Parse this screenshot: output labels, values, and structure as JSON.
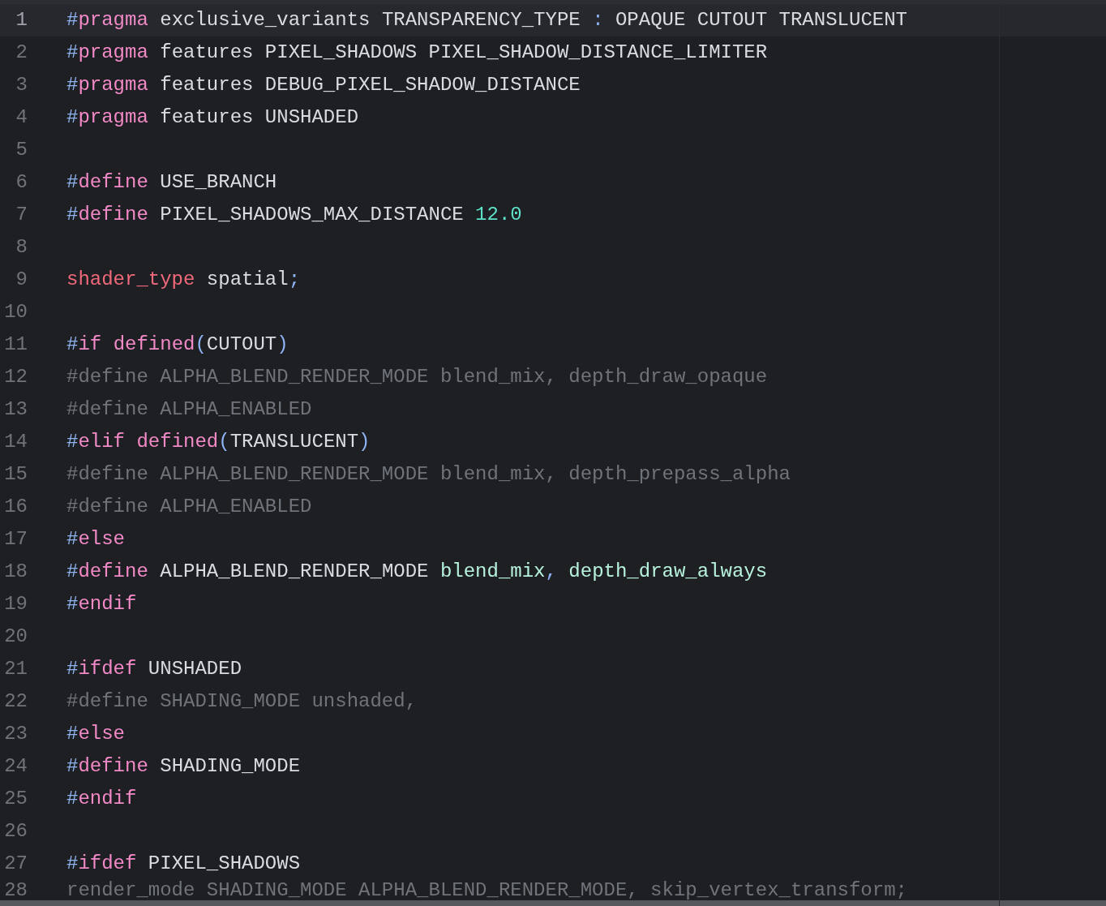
{
  "editor": {
    "lines": [
      {
        "number": "1",
        "current": true,
        "tokens": [
          {
            "kind": "hash",
            "text": "#"
          },
          {
            "kind": "directive",
            "text": "pragma"
          },
          {
            "kind": "plain",
            "text": " exclusive_variants TRANSPARENCY_TYPE "
          },
          {
            "kind": "punct",
            "text": ":"
          },
          {
            "kind": "plain",
            "text": " OPAQUE CUTOUT TRANSLUCENT"
          }
        ]
      },
      {
        "number": "2",
        "current": false,
        "tokens": [
          {
            "kind": "hash",
            "text": "#"
          },
          {
            "kind": "directive",
            "text": "pragma"
          },
          {
            "kind": "plain",
            "text": " features PIXEL_SHADOWS PIXEL_SHADOW_DISTANCE_LIMITER"
          }
        ]
      },
      {
        "number": "3",
        "current": false,
        "tokens": [
          {
            "kind": "hash",
            "text": "#"
          },
          {
            "kind": "directive",
            "text": "pragma"
          },
          {
            "kind": "plain",
            "text": " features DEBUG_PIXEL_SHADOW_DISTANCE"
          }
        ]
      },
      {
        "number": "4",
        "current": false,
        "tokens": [
          {
            "kind": "hash",
            "text": "#"
          },
          {
            "kind": "directive",
            "text": "pragma"
          },
          {
            "kind": "plain",
            "text": " features UNSHADED"
          }
        ]
      },
      {
        "number": "5",
        "current": false
      },
      {
        "number": "6",
        "current": false,
        "tokens": [
          {
            "kind": "hash",
            "text": "#"
          },
          {
            "kind": "directive",
            "text": "define"
          },
          {
            "kind": "plain",
            "text": " USE_BRANCH"
          }
        ]
      },
      {
        "number": "7",
        "current": false,
        "tokens": [
          {
            "kind": "hash",
            "text": "#"
          },
          {
            "kind": "directive",
            "text": "define"
          },
          {
            "kind": "plain",
            "text": " PIXEL_SHADOWS_MAX_DISTANCE "
          },
          {
            "kind": "number",
            "text": "12.0"
          }
        ]
      },
      {
        "number": "8",
        "current": false
      },
      {
        "number": "9",
        "current": false,
        "tokens": [
          {
            "kind": "keyword",
            "text": "shader_type"
          },
          {
            "kind": "plain",
            "text": " spatial"
          },
          {
            "kind": "punct",
            "text": ";"
          }
        ]
      },
      {
        "number": "10",
        "current": false
      },
      {
        "number": "11",
        "current": false,
        "tokens": [
          {
            "kind": "hash",
            "text": "#"
          },
          {
            "kind": "directive",
            "text": "if "
          },
          {
            "kind": "directive",
            "text": "defined"
          },
          {
            "kind": "punct",
            "text": "("
          },
          {
            "kind": "plain",
            "text": "CUTOUT"
          },
          {
            "kind": "punct",
            "text": ")"
          }
        ]
      },
      {
        "number": "12",
        "current": false,
        "tokens": [
          {
            "kind": "inactive",
            "text": "#define ALPHA_BLEND_RENDER_MODE blend_mix, depth_draw_opaque"
          }
        ]
      },
      {
        "number": "13",
        "current": false,
        "tokens": [
          {
            "kind": "inactive",
            "text": "#define ALPHA_ENABLED"
          }
        ]
      },
      {
        "number": "14",
        "current": false,
        "tokens": [
          {
            "kind": "hash",
            "text": "#"
          },
          {
            "kind": "directive",
            "text": "elif "
          },
          {
            "kind": "directive",
            "text": "defined"
          },
          {
            "kind": "punct",
            "text": "("
          },
          {
            "kind": "plain",
            "text": "TRANSLUCENT"
          },
          {
            "kind": "punct",
            "text": ")"
          }
        ]
      },
      {
        "number": "15",
        "current": false,
        "tokens": [
          {
            "kind": "inactive",
            "text": "#define ALPHA_BLEND_RENDER_MODE blend_mix, depth_prepass_alpha"
          }
        ]
      },
      {
        "number": "16",
        "current": false,
        "tokens": [
          {
            "kind": "inactive",
            "text": "#define ALPHA_ENABLED"
          }
        ]
      },
      {
        "number": "17",
        "current": false,
        "tokens": [
          {
            "kind": "hash",
            "text": "#"
          },
          {
            "kind": "directive",
            "text": "else"
          }
        ]
      },
      {
        "number": "18",
        "current": false,
        "tokens": [
          {
            "kind": "hash",
            "text": "#"
          },
          {
            "kind": "directive",
            "text": "define"
          },
          {
            "kind": "plain",
            "text": " ALPHA_BLEND_RENDER_MODE "
          },
          {
            "kind": "value",
            "text": "blend_mix"
          },
          {
            "kind": "punct",
            "text": ", "
          },
          {
            "kind": "value",
            "text": "depth_draw_always"
          }
        ]
      },
      {
        "number": "19",
        "current": false,
        "tokens": [
          {
            "kind": "hash",
            "text": "#"
          },
          {
            "kind": "directive",
            "text": "endif"
          }
        ]
      },
      {
        "number": "20",
        "current": false
      },
      {
        "number": "21",
        "current": false,
        "tokens": [
          {
            "kind": "hash",
            "text": "#"
          },
          {
            "kind": "directive",
            "text": "ifdef"
          },
          {
            "kind": "plain",
            "text": " UNSHADED"
          }
        ]
      },
      {
        "number": "22",
        "current": false,
        "tokens": [
          {
            "kind": "inactive",
            "text": "#define SHADING_MODE unshaded,"
          }
        ]
      },
      {
        "number": "23",
        "current": false,
        "tokens": [
          {
            "kind": "hash",
            "text": "#"
          },
          {
            "kind": "directive",
            "text": "else"
          }
        ]
      },
      {
        "number": "24",
        "current": false,
        "tokens": [
          {
            "kind": "hash",
            "text": "#"
          },
          {
            "kind": "directive",
            "text": "define"
          },
          {
            "kind": "plain",
            "text": " SHADING_MODE"
          }
        ]
      },
      {
        "number": "25",
        "current": false,
        "tokens": [
          {
            "kind": "hash",
            "text": "#"
          },
          {
            "kind": "directive",
            "text": "endif"
          }
        ]
      },
      {
        "number": "26",
        "current": false
      },
      {
        "number": "27",
        "current": false,
        "tokens": [
          {
            "kind": "hash",
            "text": "#"
          },
          {
            "kind": "directive",
            "text": "ifdef"
          },
          {
            "kind": "plain",
            "text": " PIXEL_SHADOWS"
          }
        ]
      },
      {
        "number": "28",
        "current": false,
        "tokens": [
          {
            "kind": "inactive",
            "text": "render_mode SHADING_MODE ALPHA_BLEND_RENDER_MODE, skip_vertex_transform;"
          }
        ]
      }
    ]
  }
}
